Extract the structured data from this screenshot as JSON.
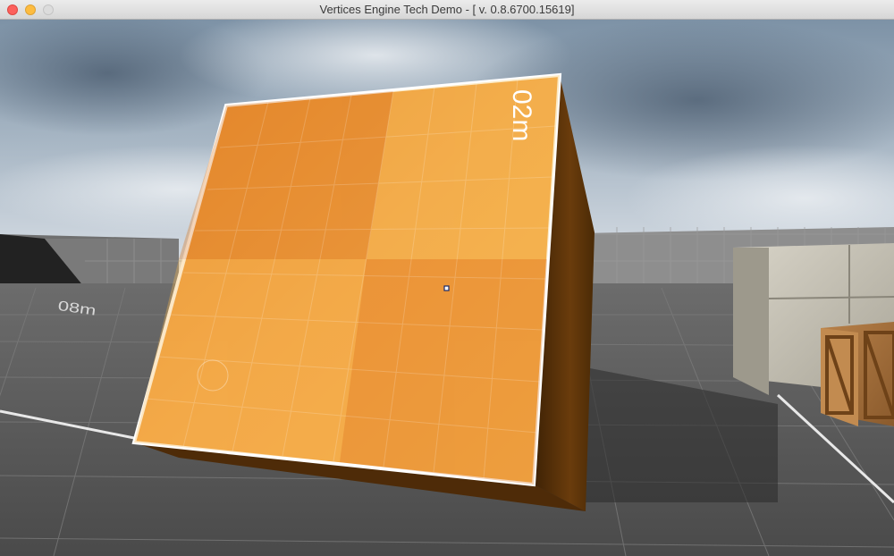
{
  "window": {
    "title": "Vertices Engine Tech Demo - [ v. 0.8.6700.15619]"
  },
  "scene": {
    "cube_label": "02m",
    "floor_label": "08m",
    "colors": {
      "sky": "#8fa3b5",
      "floor": "#5c5c5c",
      "cube_top": "#f0a040",
      "cube_side": "#5a3208",
      "crosshair": "#1a2a6a"
    }
  }
}
